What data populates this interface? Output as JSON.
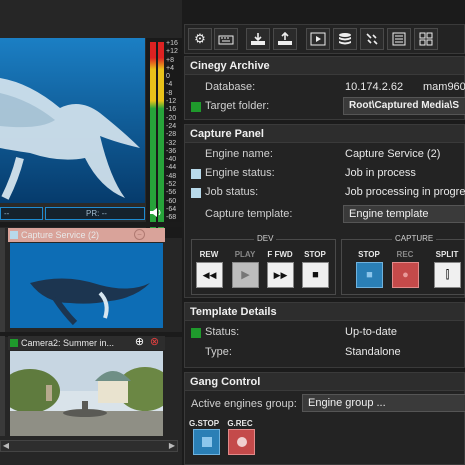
{
  "meters": {
    "scale": [
      "+16",
      "+12",
      "+8",
      "+4",
      "0",
      "-4",
      "-8",
      "-12",
      "-16",
      "-20",
      "-24",
      "-28",
      "-32",
      "-36",
      "-40",
      "-44",
      "-48",
      "-52",
      "-56",
      "-60",
      "-64",
      "-68"
    ]
  },
  "main_video": {
    "tc_left": "--",
    "tc_right": "PR: --",
    "speaker_icon": "speaker-icon"
  },
  "thumbs": [
    {
      "title": "Capture Service (2)",
      "header_color": "#d9a39a",
      "status_color": "#b8d9ea"
    },
    {
      "title": "Camera2: Summer in...",
      "header_color": "#2d2d2d",
      "status_color": "#1f9a2c"
    }
  ],
  "toolbar": {
    "icons": [
      "gear-icon",
      "keyboard-icon",
      "download-icon",
      "upload-icon",
      "play-icon",
      "database-icon",
      "tools-icon",
      "list-icon",
      "grid-icon"
    ]
  },
  "cinegy_archive": {
    "title": "Cinegy Archive",
    "database_label": "Database:",
    "database_value": "10.174.2.62",
    "database_name": "mam960",
    "target_label": "Target folder:",
    "target_value": "Root\\Captured Media\\S"
  },
  "capture_panel": {
    "title": "Capture Panel",
    "engine_name_label": "Engine name:",
    "engine_name_value": "Capture Service (2)",
    "engine_status_label": "Engine status:",
    "engine_status_value": "Job in process",
    "job_status_label": "Job status:",
    "job_status_value": "Job processing in progre",
    "template_label": "Capture template:",
    "template_value": "Engine template",
    "dev_group": "DEV",
    "capture_group": "CAPTURE",
    "dev_buttons": [
      {
        "label": "REW",
        "glyph": "◀◀"
      },
      {
        "label": "PLAY",
        "glyph": "▶"
      },
      {
        "label": "F FWD",
        "glyph": "▶▶"
      },
      {
        "label": "STOP",
        "glyph": "■"
      }
    ],
    "capture_buttons": [
      {
        "label": "STOP",
        "glyph": "■"
      },
      {
        "label": "REC",
        "glyph": "●"
      },
      {
        "label": "SPLIT",
        "glyph": "⫿"
      }
    ]
  },
  "template_details": {
    "title": "Template Details",
    "status_label": "Status:",
    "status_value": "Up-to-date",
    "type_label": "Type:",
    "type_value": "Standalone"
  },
  "gang_control": {
    "title": "Gang Control",
    "engines_label": "Active engines group:",
    "engines_value": "Engine group ...",
    "gstop_label": "G.STOP",
    "grec_label": "G.REC"
  }
}
